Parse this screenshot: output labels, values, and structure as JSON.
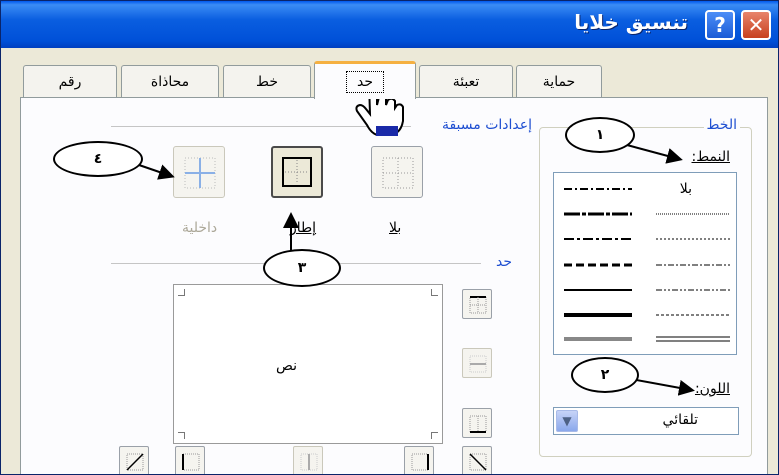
{
  "window": {
    "title": "تنسيق خلايا",
    "help_glyph": "?",
    "close_glyph": "✕"
  },
  "tabs": [
    {
      "label": "رقم"
    },
    {
      "label": "محاذاة"
    },
    {
      "label": "خط"
    },
    {
      "label": "حد"
    },
    {
      "label": "تعبئة"
    },
    {
      "label": "حماية"
    }
  ],
  "active_tab": "حد",
  "presets": {
    "section_label": "إعدادات مسبقة",
    "none_label": "بلا",
    "outline_label": "إطار",
    "inside_label": "داخلية"
  },
  "border_section_label": "حد",
  "line": {
    "section_label": "الخط",
    "style_label": "النمط:",
    "style_none": "بلا",
    "color_label": "اللون:",
    "color_value": "تلقائي"
  },
  "preview": {
    "text": "نص"
  },
  "annotations": [
    {
      "number": "١"
    },
    {
      "number": "٢"
    },
    {
      "number": "٣"
    },
    {
      "number": "٤"
    }
  ],
  "colors": {
    "titlebar": "#0a5ee0",
    "section_label": "#1f4fd1",
    "active_tab_accent": "#f5b041"
  }
}
